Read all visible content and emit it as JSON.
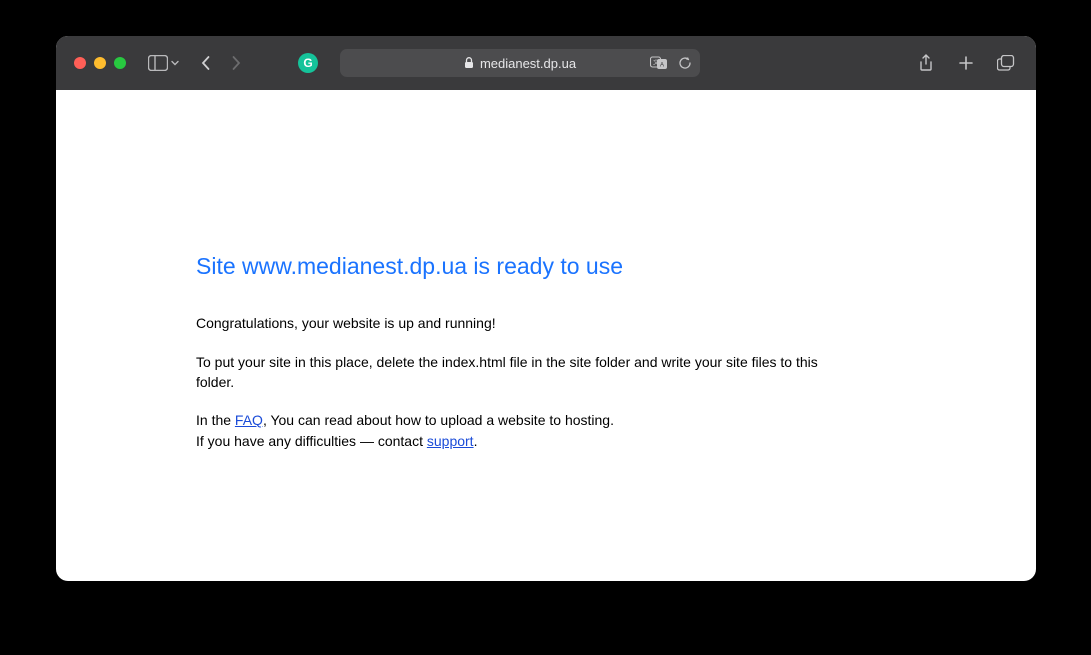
{
  "browser": {
    "url_display": "medianest.dp.ua",
    "extension_letter": "G"
  },
  "page": {
    "heading": "Site www.medianest.dp.ua is ready to use",
    "p1": "Congratulations, your website is up and running!",
    "p2": "To put your site in this place, delete the index.html file in the site folder and write your site files to this folder.",
    "p3_pre": "In the ",
    "faq_label": "FAQ",
    "p3_post": ", You can read about how to upload a website to hosting.",
    "p4_pre": "If you have any difficulties — contact ",
    "support_label": "support",
    "p4_post": "."
  }
}
